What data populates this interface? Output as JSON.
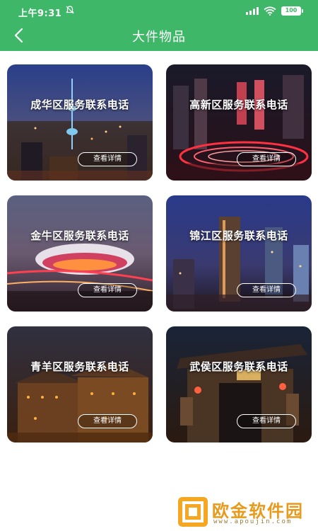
{
  "status_bar": {
    "time": "上午9:31",
    "battery": "100"
  },
  "header": {
    "title": "大件物品"
  },
  "cards": [
    {
      "title": "成华区服务联系电话",
      "button": "查看详情"
    },
    {
      "title": "高新区服务联系电话",
      "button": "查看详情"
    },
    {
      "title": "金牛区服务联系电话",
      "button": "查看详情"
    },
    {
      "title": "锦江区服务联系电话",
      "button": "查看详情"
    },
    {
      "title": "青羊区服务联系电话",
      "button": "查看详情"
    },
    {
      "title": "武侯区服务联系电话",
      "button": "查看详情"
    }
  ],
  "watermark": {
    "name": "欧金软件园",
    "url": "www.apoujin.com"
  },
  "colors": {
    "header_green": "#3fb769",
    "watermark_orange": "#f5a623"
  }
}
